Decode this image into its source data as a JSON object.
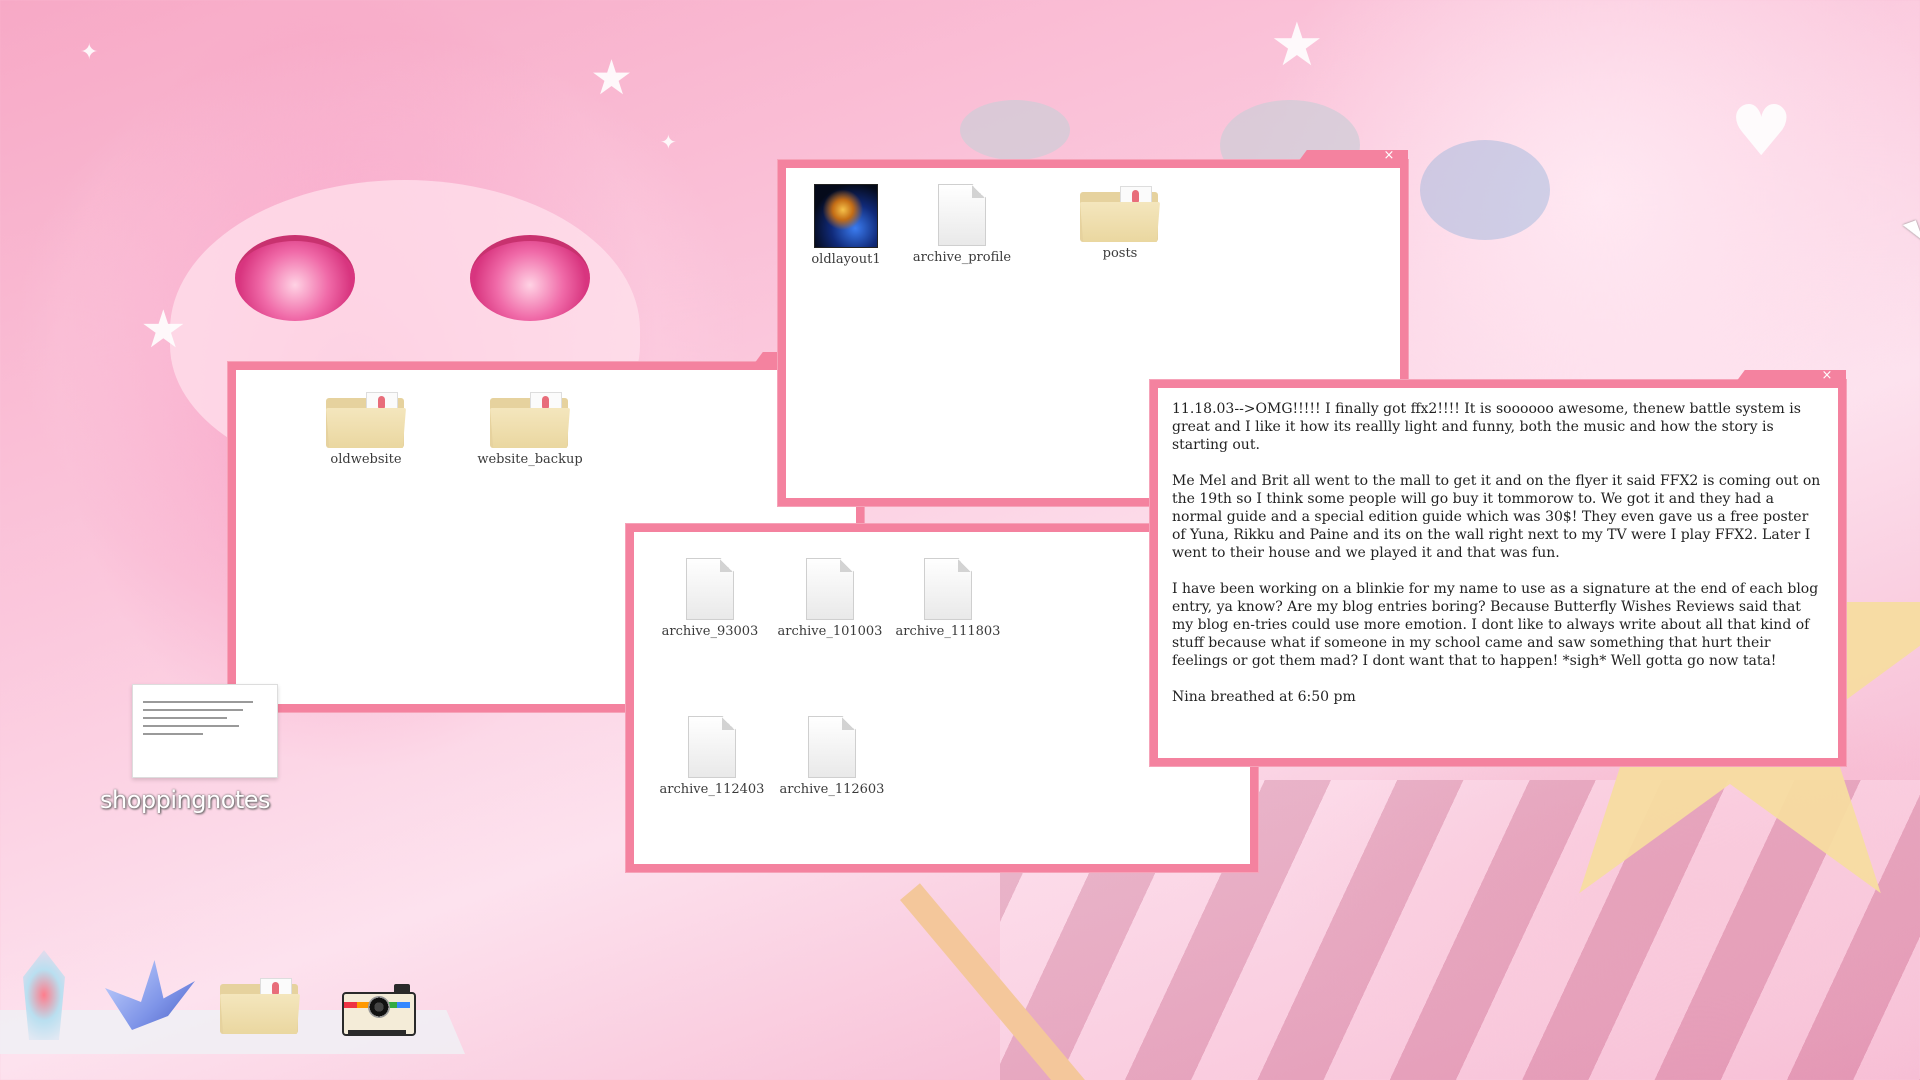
{
  "desktop": {
    "note_file_label": "shoppingnotes"
  },
  "windows": {
    "old_site": {
      "files": [
        {
          "name": "oldlayout1",
          "icon": "image-thumbnail-icon"
        },
        {
          "name": "archive_profile",
          "icon": "document-icon"
        },
        {
          "name": "posts",
          "icon": "folder-icon"
        }
      ]
    },
    "website": {
      "files": [
        {
          "name": "oldwebsite",
          "icon": "folder-icon"
        },
        {
          "name": "website_backup",
          "icon": "folder-icon"
        }
      ]
    },
    "archives": {
      "files": [
        {
          "name": "archive_93003",
          "icon": "document-icon"
        },
        {
          "name": "archive_101003",
          "icon": "document-icon"
        },
        {
          "name": "archive_111803",
          "icon": "document-icon"
        },
        {
          "name": "archive_112403",
          "icon": "document-icon"
        },
        {
          "name": "archive_112603",
          "icon": "document-icon"
        }
      ]
    },
    "blog_entry": {
      "paragraphs": [
        "11.18.03-->OMG!!!!! I finally got ffx2!!!! It is soooooo awesome, thenew battle system is great and I like it how its reallly light and funny, both the music and how the story is starting out.",
        "Me Mel and Brit all went to the mall to get it and on the flyer it said FFX2 is coming out on the 19th so I think some people will go buy it tommorow to. We got it and they had a normal guide and a special edition guide which was 30$! They even gave us a free poster of Yuna, Rikku and Paine and its on the wall right next to my TV were I play FFX2. Later I went to their house and we played it and that was fun.",
        "I have been working on a blinkie for my name to use as a signature at the end of each blog entry, ya know? Are my blog entries boring? Because Butterfly Wishes Reviews said that my blog en-tries could use more emotion. I dont like to always write about all that kind of stuff because what if someone in my school came and saw something that hurt their feelings or got them mad? I dont want that to happen! *sigh* Well gotta go now tata!",
        "Nina breathed at 6:50 pm"
      ]
    },
    "close_glyph": "×"
  },
  "dock": {
    "items": [
      "crystal-icon",
      "paper-crane-icon",
      "folder-icon",
      "camera-icon"
    ]
  },
  "colors": {
    "window_border": "#f4829f",
    "folder": "#ead7a0"
  }
}
